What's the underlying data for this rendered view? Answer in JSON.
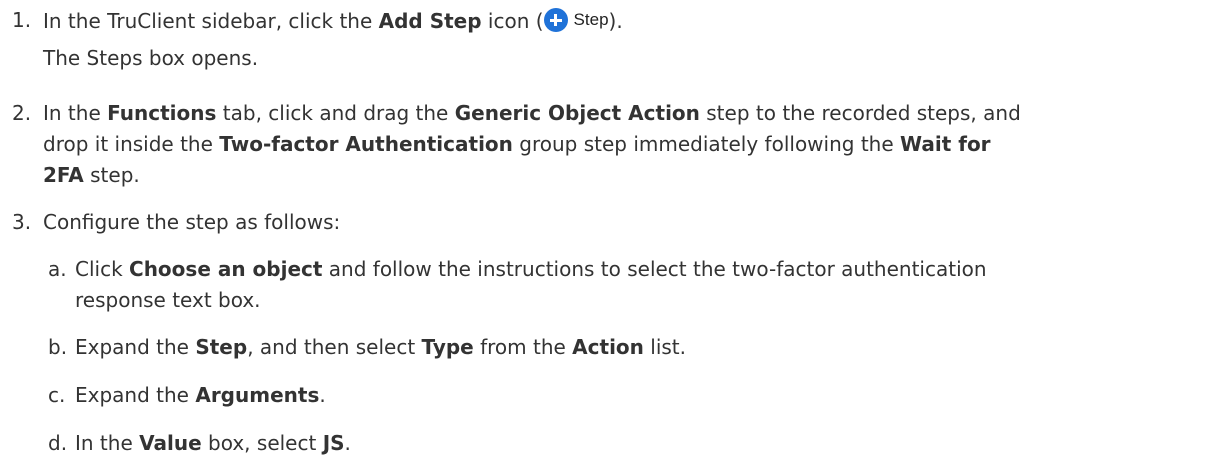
{
  "steps": [
    {
      "number": "1.",
      "parts": [
        "In the TruClient sidebar, click the ",
        "Add Step",
        " icon (",
        ")."
      ],
      "icon": {
        "name": "add-step-icon",
        "label": "Step",
        "color": "#1f72d8"
      },
      "note": "The Steps box opens."
    },
    {
      "number": "2.",
      "line1": [
        "In the ",
        "Functions",
        " tab, click and drag the ",
        "Generic Object Action",
        " step to the recorded steps, and"
      ],
      "line2": [
        "drop it inside the ",
        "Two-factor Authentication",
        " group step immediately following the ",
        "Wait for"
      ],
      "line3": [
        "2FA",
        " step."
      ]
    },
    {
      "number": "3.",
      "text": "Configure the step as follows:",
      "substeps": [
        {
          "letter": "a.",
          "line1": [
            "Click ",
            "Choose an object",
            " and follow the instructions to select the two-factor authentication"
          ],
          "line2": "response text box."
        },
        {
          "letter": "b.",
          "parts": [
            "Expand the ",
            "Step",
            ", and then select ",
            "Type",
            " from the ",
            "Action",
            " list."
          ]
        },
        {
          "letter": "c.",
          "parts": [
            "Expand the ",
            "Arguments",
            "."
          ]
        },
        {
          "letter": "d.",
          "parts": [
            "In the ",
            "Value",
            " box, select ",
            "JS",
            "."
          ]
        }
      ]
    }
  ]
}
